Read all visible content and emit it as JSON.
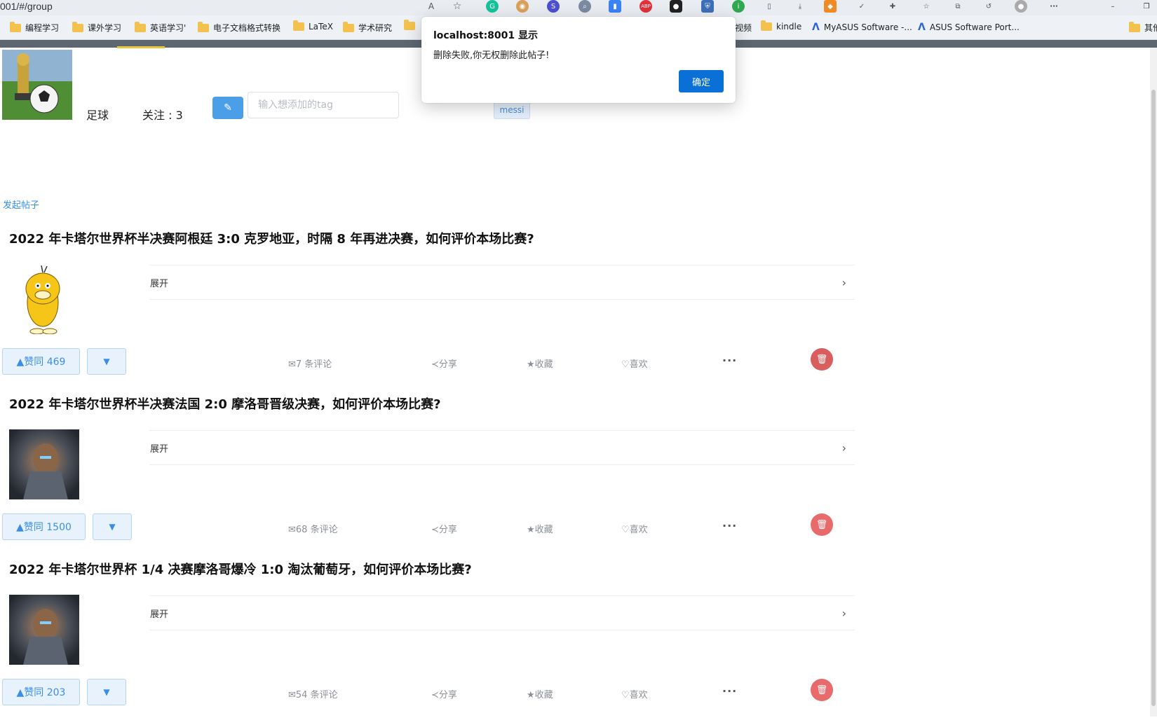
{
  "browser": {
    "url": "001/#/group",
    "bookmarks": [
      {
        "label": "编程学习",
        "type": "folder"
      },
      {
        "label": "课外学习",
        "type": "folder"
      },
      {
        "label": "英语学习'",
        "type": "folder"
      },
      {
        "label": "电子文档格式转换",
        "type": "folder"
      },
      {
        "label": "LaTeX",
        "type": "folder"
      },
      {
        "label": "学术研究",
        "type": "folder"
      },
      {
        "label": "",
        "type": "folder"
      },
      {
        "label": "视频",
        "type": "folder"
      },
      {
        "label": "kindle",
        "type": "folder"
      },
      {
        "label": "MyASUS Software -...",
        "type": "link"
      },
      {
        "label": "ASUS Software Port...",
        "type": "link"
      },
      {
        "label": "其他",
        "type": "folder"
      }
    ],
    "window_controls": {
      "minimize": "–",
      "restore": "❐"
    }
  },
  "group": {
    "name": "足球",
    "follow_label": "关注 : 3",
    "edit_icon": "✎",
    "tag_placeholder": "输入想添加的tag",
    "tags": [
      "messi"
    ],
    "new_post_label": "发起帖子"
  },
  "posts": [
    {
      "title": "2022 年卡塔尔世界杯半决赛阿根廷 3:0 克罗地亚，时隔 8 年再进决赛，如何评价本场比赛?",
      "thumb": "duck",
      "expand_label": "展开",
      "vote_label": "▲赞同 469",
      "comments_label": "✉7 条评论",
      "share_label": "分享",
      "favorite_label": "★收藏",
      "like_label": "喜欢"
    },
    {
      "title": "2022 年卡塔尔世界杯半决赛法国 2:0 摩洛哥晋级决赛，如何评价本场比赛?",
      "thumb": "warrior",
      "expand_label": "展开",
      "vote_label": "▲赞同 1500",
      "comments_label": "✉68 条评论",
      "share_label": "分享",
      "favorite_label": "★收藏",
      "like_label": "喜欢"
    },
    {
      "title": "2022 年卡塔尔世界杯 1/4 决赛摩洛哥爆冷 1:0 淘汰葡萄牙，如何评价本场比赛?",
      "thumb": "warrior",
      "expand_label": "展开",
      "vote_label": "▲赞同 203",
      "comments_label": "✉54 条评论",
      "share_label": "分享",
      "favorite_label": "★收藏",
      "like_label": "喜欢"
    }
  ],
  "dialog": {
    "title": "localhost:8001 显示",
    "message": "删除失败,你无权删除此帖子!",
    "ok_label": "确定"
  },
  "colors": {
    "primary": "#3a8ee6",
    "danger": "#e86a6a",
    "dialog_button": "#0a6fd6"
  }
}
